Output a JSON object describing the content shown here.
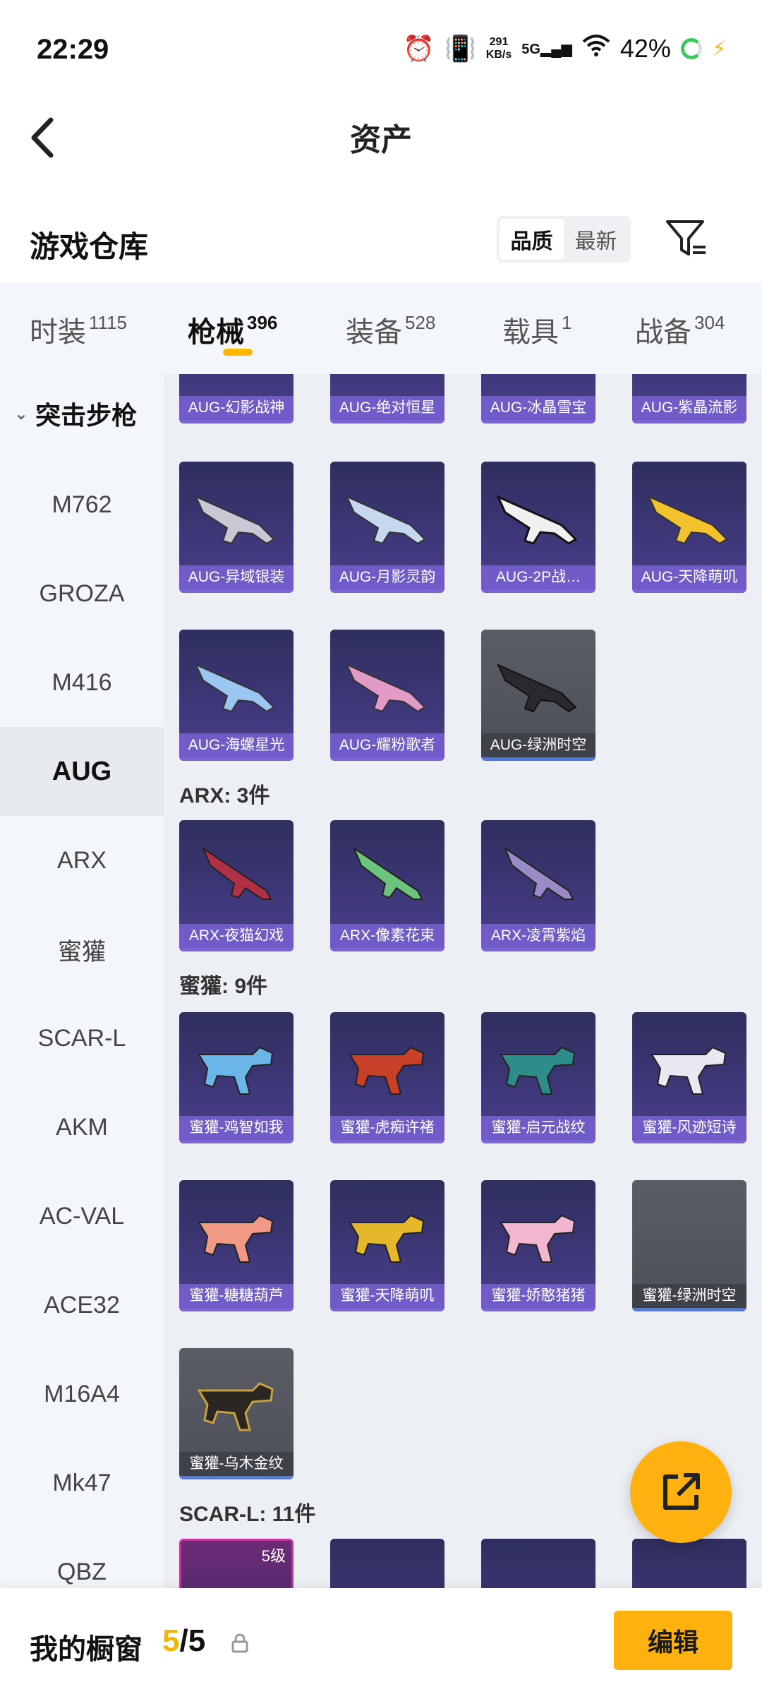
{
  "status_bar": {
    "time": "22:29",
    "net_speed_value": "291",
    "net_speed_unit": "KB/s",
    "network": "5G",
    "battery": "42%"
  },
  "header": {
    "title": "资产"
  },
  "warehouse": {
    "title": "游戏仓库",
    "sort_options": [
      "品质",
      "最新"
    ],
    "sort_selected": "品质"
  },
  "tabs": [
    {
      "label": "时装",
      "count": "1115"
    },
    {
      "label": "枪械",
      "count": "396"
    },
    {
      "label": "装备",
      "count": "528"
    },
    {
      "label": "载具",
      "count": "1"
    },
    {
      "label": "战备",
      "count": "304"
    }
  ],
  "tabs_active": "枪械",
  "sidebar": {
    "category": "突击步枪",
    "items": [
      "M762",
      "GROZA",
      "M416",
      "AUG",
      "ARX",
      "蜜獾",
      "SCAR-L",
      "AKM",
      "AC-VAL",
      "ACE32",
      "M16A4",
      "Mk47",
      "QBZ"
    ],
    "active": "AUG"
  },
  "content": {
    "aug_top_row": [
      "AUG-幻影战神",
      "AUG-绝对恒星",
      "AUG-冰晶雪宝",
      "AUG-紫晶流影"
    ],
    "aug_row2": [
      "AUG-异域银装",
      "AUG-月影灵韵",
      "AUG-2P战…",
      "AUG-天降萌叽"
    ],
    "aug_row3": [
      "AUG-海螺星光",
      "AUG-耀粉歌者",
      "AUG-绿洲时空"
    ],
    "arx_header": "ARX: 3件",
    "arx_items": [
      "ARX-夜猫幻戏",
      "ARX-像素花束",
      "ARX-凌霄紫焰"
    ],
    "honey_header": "蜜獾: 9件",
    "honey_row1": [
      "蜜獾-鸡智如我",
      "蜜獾-虎痴许褚",
      "蜜獾-启元战纹",
      "蜜獾-风迹短诗"
    ],
    "honey_row2": [
      "蜜獾-糖糖葫芦",
      "蜜獾-天降萌叽",
      "蜜獾-娇憨猪猪",
      "蜜獾-绿洲时空"
    ],
    "honey_row3": [
      "蜜獾-乌木金纹"
    ],
    "scar_header": "SCAR-L: 11件",
    "scar_first_level": "5级"
  },
  "bottom_bar": {
    "label": "我的橱窗",
    "count_current": "5",
    "count_separator": "/5",
    "edit_label": "编辑"
  },
  "colors": {
    "accent": "#ffb20f",
    "card_purple": "#3a3572",
    "card_gray": "#55575f"
  }
}
